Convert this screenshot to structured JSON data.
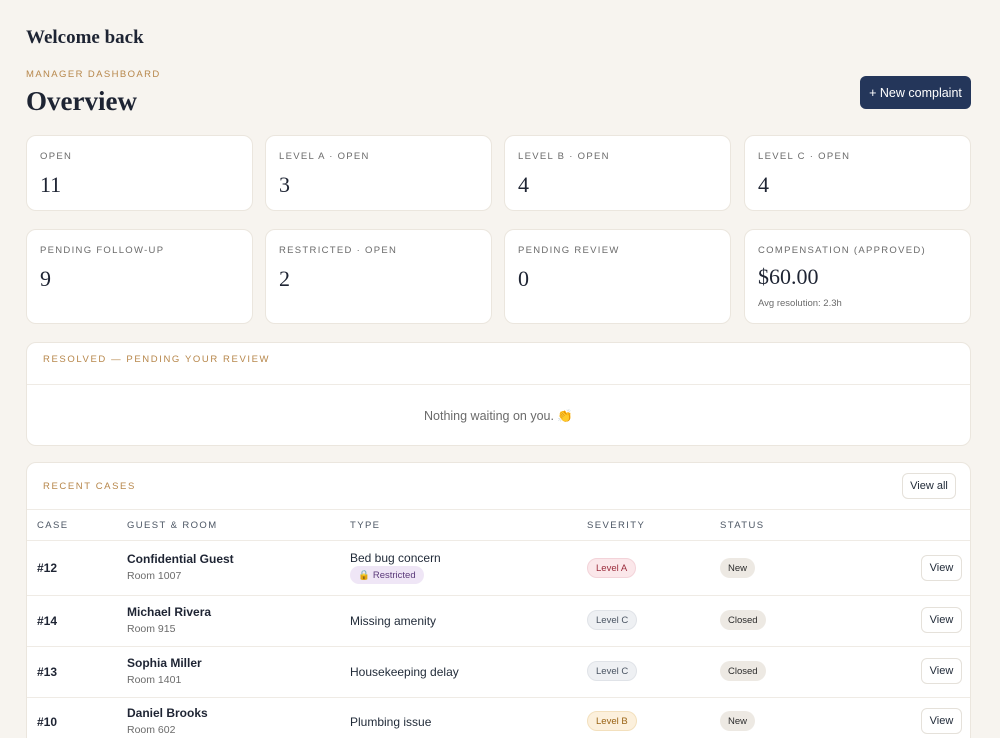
{
  "header": {
    "welcome": "Welcome back",
    "eyebrow": "MANAGER DASHBOARD",
    "title": "Overview",
    "new_button": "+ New complaint"
  },
  "stats": [
    {
      "label": "OPEN",
      "value": "11"
    },
    {
      "label": "LEVEL A · OPEN",
      "value": "3"
    },
    {
      "label": "LEVEL B · OPEN",
      "value": "4"
    },
    {
      "label": "LEVEL C · OPEN",
      "value": "4"
    },
    {
      "label": "PENDING FOLLOW-UP",
      "value": "9"
    },
    {
      "label": "RESTRICTED · OPEN",
      "value": "2"
    },
    {
      "label": "PENDING REVIEW",
      "value": "0"
    },
    {
      "label": "COMPENSATION (APPROVED)",
      "value": "$60.00",
      "sub": "Avg resolution: 2.3h"
    }
  ],
  "review_section": {
    "label": "RESOLVED — PENDING YOUR REVIEW",
    "empty_message": "Nothing waiting on you. 👏"
  },
  "recent_cases": {
    "label": "RECENT CASES",
    "view_all": "View all",
    "columns": [
      "CASE",
      "GUEST & ROOM",
      "TYPE",
      "SEVERITY",
      "STATUS"
    ],
    "rows": [
      {
        "case": "#12",
        "guest": "Confidential Guest",
        "room": "Room 1007",
        "type": "Bed bug concern",
        "tag": "Restricted",
        "severity": "Level A",
        "status": "New",
        "action": "View"
      },
      {
        "case": "#14",
        "guest": "Michael Rivera",
        "room": "Room 915",
        "type": "Missing amenity",
        "severity": "Level C",
        "status": "Closed",
        "action": "View"
      },
      {
        "case": "#13",
        "guest": "Sophia Miller",
        "room": "Room 1401",
        "type": "Housekeeping delay",
        "severity": "Level C",
        "status": "Closed",
        "action": "View"
      },
      {
        "case": "#10",
        "guest": "Daniel Brooks",
        "room": "Room 602",
        "type": "Plumbing issue",
        "severity": "Level B",
        "status": "New",
        "action": "View"
      }
    ]
  },
  "colors": {
    "background": "#f7f4ef",
    "primary_button": "#24365a",
    "accent_label": "#b7874b",
    "severity_a": "#9b2c3c",
    "severity_b": "#9a6416",
    "severity_c": "#4b5563",
    "restricted": "#5b3a7a"
  },
  "icons": {
    "restricted": "lock-icon"
  }
}
